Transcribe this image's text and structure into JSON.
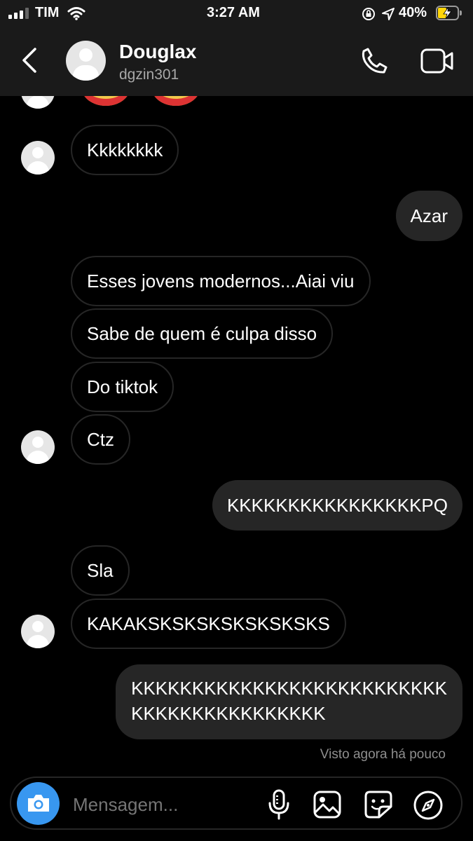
{
  "status": {
    "carrier": "TIM",
    "time": "3:27 AM",
    "battery_percent": "40%",
    "signal_bars_filled": 3,
    "battery_level": 0.4
  },
  "header": {
    "name": "Douglax",
    "username": "dgzin301"
  },
  "messages": [
    {
      "from": "them",
      "text": "Kkkkkkkk",
      "avatar": true
    },
    {
      "from": "me",
      "text": "Azar"
    },
    {
      "from": "them",
      "text": "Esses jovens modernos...Aiai viu"
    },
    {
      "from": "them",
      "text": "Sabe de quem é culpa disso"
    },
    {
      "from": "them",
      "text": "Do tiktok"
    },
    {
      "from": "them",
      "text": "Ctz",
      "avatar": true
    },
    {
      "from": "me",
      "text": "KKKKKKKKKKKKKKKKPQ"
    },
    {
      "from": "them",
      "text": "Sla"
    },
    {
      "from": "them",
      "text": "KAKAKSKSKSKSKSKSKSKS",
      "avatar": true
    },
    {
      "from": "me",
      "lines": [
        "KKKKKKKKKKKKKKKKKKKKKKKKKK",
        "KKKKKKKKKKKKKKKK"
      ]
    }
  ],
  "seen_label": "Visto agora há pouco",
  "composer": {
    "placeholder": "Mensagem...",
    "icons": [
      "camera-icon",
      "microphone-icon",
      "gallery-icon",
      "sticker-icon",
      "explore-icon"
    ]
  },
  "colors": {
    "bar_background": "#1a1a1a",
    "outgoing_bubble": "#262626",
    "camera_button": "#3897f0",
    "battery_charging": "#ffd60a"
  }
}
